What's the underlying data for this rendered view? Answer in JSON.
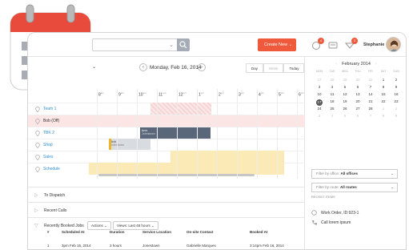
{
  "topbar": {
    "search_placeholder": "",
    "create_label": "Create New",
    "notif_count_1": "4",
    "notif_count_2": "3",
    "user_name": "Stephanie"
  },
  "calendar": {
    "view_selector_arrow": "⌄",
    "date_label": "Monday, Feb 16, 2014",
    "views": [
      "Day",
      "Week",
      "Today"
    ],
    "hours": [
      {
        "h": "8",
        "ap": "am"
      },
      {
        "h": "9",
        "ap": "am"
      },
      {
        "h": "10",
        "ap": "am"
      },
      {
        "h": "11",
        "ap": "am"
      },
      {
        "h": "12",
        "ap": "pm"
      },
      {
        "h": "1",
        "ap": "pm"
      },
      {
        "h": "2",
        "ap": "pm"
      },
      {
        "h": "3",
        "ap": "pm"
      },
      {
        "h": "4",
        "ap": "pm"
      },
      {
        "h": "5",
        "ap": "pm"
      },
      {
        "h": "6",
        "ap": "pm"
      }
    ],
    "rows": [
      "Team 1",
      "Bob (Off)",
      "TBK 2",
      "Shop",
      "Sales",
      "Schedule"
    ],
    "events": {
      "e1_title": "Arch.",
      "e1_sub": "Johnstown",
      "e2_title": "Arch.",
      "e2_sub": "Johnstown"
    }
  },
  "sections": {
    "to_dispatch": "To Dispatch",
    "recent_calls": "Recent Calls",
    "recently_booked": "Recently Booked Jobs",
    "actions_label": "Actions",
    "views_label": "Views: Last 48 hours"
  },
  "table": {
    "headers": [
      "#",
      "Scheduled At",
      "Duration",
      "Service Location",
      "On-site Contact",
      "Booked At"
    ],
    "rows": [
      [
        "1",
        "3pm Feb 16, 2014",
        "3 hours",
        "Jonestown",
        "Gabrielle Marques",
        "3:14pm Feb 16, 2014"
      ]
    ]
  },
  "sidebar": {
    "month": "February 2014",
    "dow": [
      "MON",
      "TUE",
      "WED",
      "THU",
      "FRI",
      "SAT",
      "SUN"
    ],
    "weeks": [
      [
        "27",
        "28",
        "29",
        "30",
        "31",
        "1",
        "2"
      ],
      [
        "3",
        "4",
        "5",
        "6",
        "7",
        "8",
        "9"
      ],
      [
        "10",
        "11",
        "12",
        "13",
        "14",
        "15",
        "16"
      ],
      [
        "17",
        "18",
        "19",
        "20",
        "21",
        "22",
        "23"
      ],
      [
        "24",
        "25",
        "26",
        "27",
        "28",
        "1",
        "2"
      ],
      [
        "3",
        "4",
        "5",
        "6",
        "7",
        "8",
        "9"
      ]
    ],
    "filter_office": "Filter by office:",
    "filter_office_val": "All offices",
    "filter_route": "Filter by route:",
    "filter_route_val": "All routes",
    "recent_heading": "RECENT ITEMS",
    "recent_items": [
      "Work Order, ID:923-1",
      "Call lorem ipsum"
    ]
  },
  "colors": {
    "accent": "#ee5a3b",
    "link": "#2f8fd6",
    "event_dark": "#5a6679",
    "event_light": "#d8dbe0",
    "unavail": "#f9dede",
    "yellow": "#fbe9b6"
  }
}
